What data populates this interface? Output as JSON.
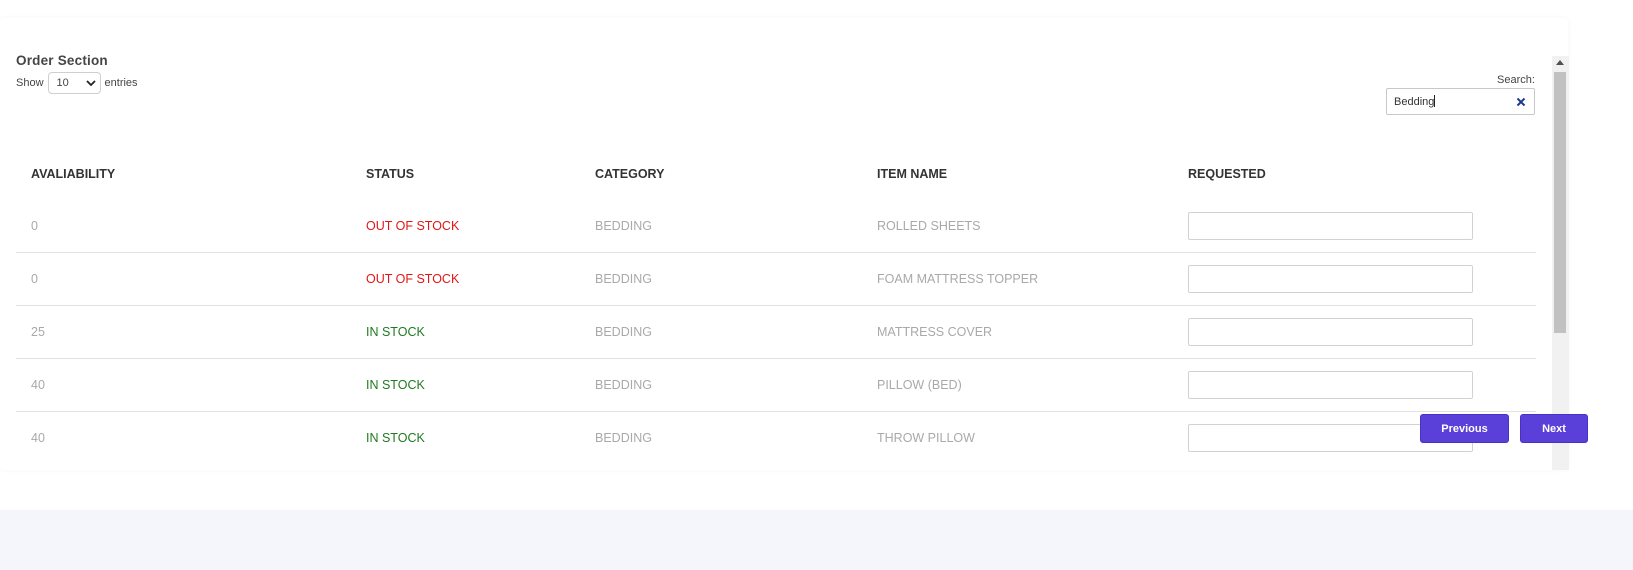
{
  "card": {
    "title": "Order Section"
  },
  "length": {
    "show_label": "Show",
    "selected": "10",
    "entries_label": "entries"
  },
  "search": {
    "label": "Search:",
    "value": "Bedding"
  },
  "table": {
    "columns": [
      "AVALIABILITY",
      "STATUS",
      "CATEGORY",
      "ITEM NAME",
      "REQUESTED"
    ],
    "rows": [
      {
        "availability": "0",
        "status": "OUT OF STOCK",
        "status_type": "out",
        "category": "BEDDING",
        "item": "ROLLED SHEETS"
      },
      {
        "availability": "0",
        "status": "OUT OF STOCK",
        "status_type": "out",
        "category": "BEDDING",
        "item": "FOAM MATTRESS TOPPER"
      },
      {
        "availability": "25",
        "status": "IN STOCK",
        "status_type": "in",
        "category": "BEDDING",
        "item": "MATTRESS COVER"
      },
      {
        "availability": "40",
        "status": "IN STOCK",
        "status_type": "in",
        "category": "BEDDING",
        "item": "PILLOW (BED)"
      },
      {
        "availability": "40",
        "status": "IN STOCK",
        "status_type": "in",
        "category": "BEDDING",
        "item": "THROW PILLOW"
      }
    ]
  },
  "pagination": {
    "previous_label": "Previous",
    "next_label": "Next"
  },
  "colors": {
    "accent": "#5a3fd9",
    "out_of_stock": "#e31616",
    "in_stock": "#1f7a1f"
  },
  "icons": {
    "clear": "close-icon",
    "dropdown": "chevron-down-icon",
    "scroll_up": "arrow-up-icon"
  }
}
